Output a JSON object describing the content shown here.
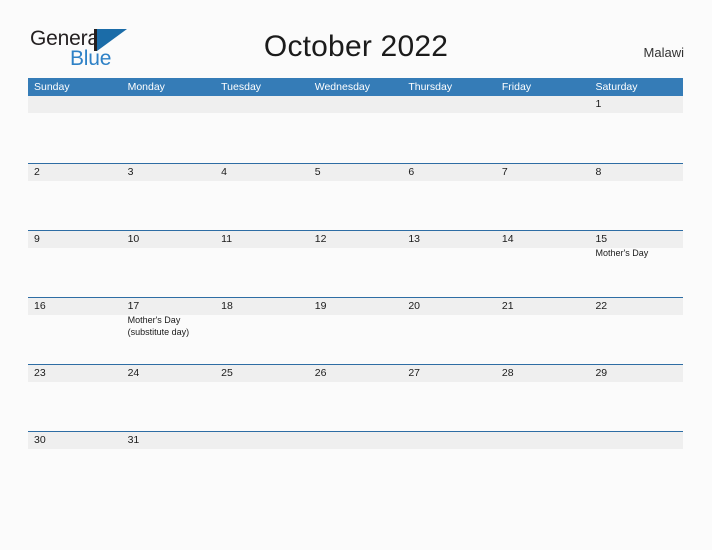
{
  "brand": {
    "name_part1": "General",
    "name_part2": "Blue",
    "mark_icon": "sailboat-logo-icon"
  },
  "header": {
    "title": "October 2022",
    "country": "Malawi"
  },
  "calendar": {
    "month": "October",
    "year": "2022",
    "weekday_headers": [
      "Sunday",
      "Monday",
      "Tuesday",
      "Wednesday",
      "Thursday",
      "Friday",
      "Saturday"
    ],
    "colors": {
      "header_blue": "#357cb7",
      "row_divider_blue": "#2e6da4",
      "date_band_gray": "#efefef",
      "page_background": "#fbfbfb",
      "brand_blue": "#2e81c6"
    },
    "weeks": [
      [
        {
          "day": "",
          "events": []
        },
        {
          "day": "",
          "events": []
        },
        {
          "day": "",
          "events": []
        },
        {
          "day": "",
          "events": []
        },
        {
          "day": "",
          "events": []
        },
        {
          "day": "",
          "events": []
        },
        {
          "day": "1",
          "events": []
        }
      ],
      [
        {
          "day": "2",
          "events": []
        },
        {
          "day": "3",
          "events": []
        },
        {
          "day": "4",
          "events": []
        },
        {
          "day": "5",
          "events": []
        },
        {
          "day": "6",
          "events": []
        },
        {
          "day": "7",
          "events": []
        },
        {
          "day": "8",
          "events": []
        }
      ],
      [
        {
          "day": "9",
          "events": []
        },
        {
          "day": "10",
          "events": []
        },
        {
          "day": "11",
          "events": []
        },
        {
          "day": "12",
          "events": []
        },
        {
          "day": "13",
          "events": []
        },
        {
          "day": "14",
          "events": []
        },
        {
          "day": "15",
          "events": [
            "Mother's Day"
          ]
        }
      ],
      [
        {
          "day": "16",
          "events": []
        },
        {
          "day": "17",
          "events": [
            "Mother's Day",
            "(substitute day)"
          ]
        },
        {
          "day": "18",
          "events": []
        },
        {
          "day": "19",
          "events": []
        },
        {
          "day": "20",
          "events": []
        },
        {
          "day": "21",
          "events": []
        },
        {
          "day": "22",
          "events": []
        }
      ],
      [
        {
          "day": "23",
          "events": []
        },
        {
          "day": "24",
          "events": []
        },
        {
          "day": "25",
          "events": []
        },
        {
          "day": "26",
          "events": []
        },
        {
          "day": "27",
          "events": []
        },
        {
          "day": "28",
          "events": []
        },
        {
          "day": "29",
          "events": []
        }
      ],
      [
        {
          "day": "30",
          "events": []
        },
        {
          "day": "31",
          "events": []
        },
        {
          "day": "",
          "events": []
        },
        {
          "day": "",
          "events": []
        },
        {
          "day": "",
          "events": []
        },
        {
          "day": "",
          "events": []
        },
        {
          "day": "",
          "events": []
        }
      ]
    ]
  }
}
